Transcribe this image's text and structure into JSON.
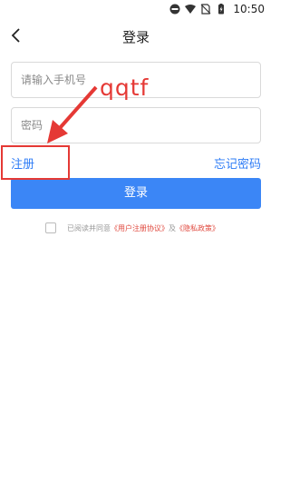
{
  "status_bar": {
    "time": "10:50",
    "icons": [
      "do-not-disturb-icon",
      "wifi-icon",
      "no-sim-icon",
      "battery-icon"
    ]
  },
  "nav": {
    "title": "登录",
    "back_icon": "chevron-left-icon"
  },
  "form": {
    "phone_placeholder": "请输入手机号",
    "password_placeholder": "密码",
    "register_label": "注册",
    "forgot_label": "忘记密码",
    "login_label": "登录"
  },
  "agreement": {
    "prefix": "已阅读并同意",
    "user_agreement": "《用户注册协议》",
    "and": "及",
    "privacy_policy": "《隐私政策》",
    "checked": false
  },
  "annotation": {
    "text": "qqtf",
    "color": "#e53935"
  },
  "colors": {
    "accent": "#3b86f6",
    "link": "#2e7cf6",
    "policy_link": "#e04a3f"
  }
}
